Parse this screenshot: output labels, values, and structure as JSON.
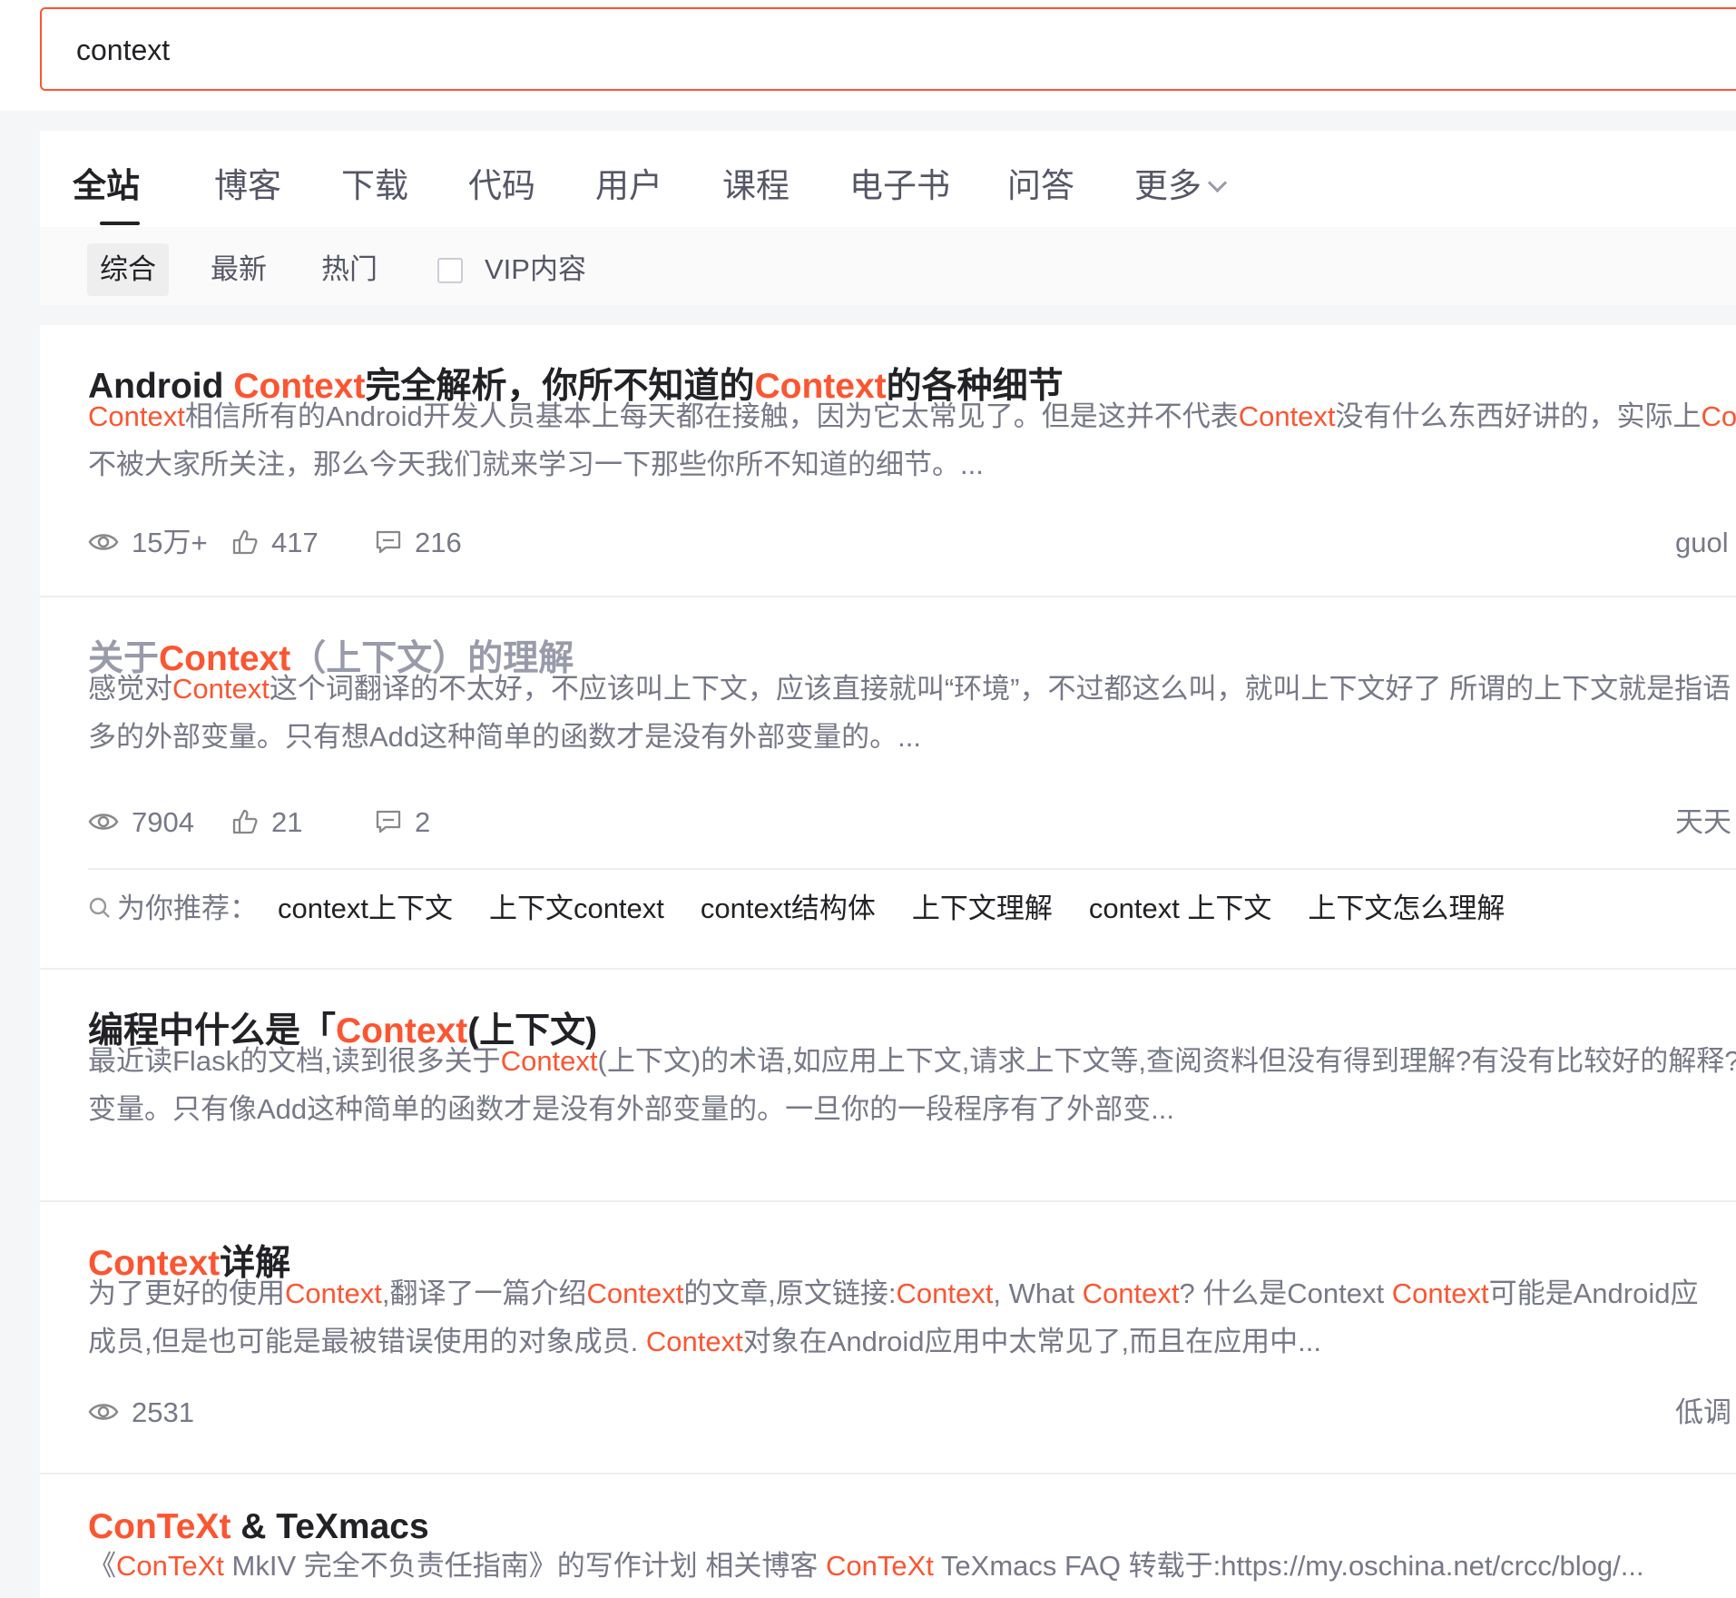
{
  "search": {
    "value": "context"
  },
  "tabs": [
    {
      "label": "全站"
    },
    {
      "label": "博客"
    },
    {
      "label": "下载"
    },
    {
      "label": "代码"
    },
    {
      "label": "用户"
    },
    {
      "label": "课程"
    },
    {
      "label": "电子书"
    },
    {
      "label": "问答"
    },
    {
      "label": "更多"
    }
  ],
  "filters": {
    "items": [
      {
        "label": "综合"
      },
      {
        "label": "最新"
      },
      {
        "label": "热门"
      }
    ],
    "vip_label": "VIP内容",
    "vip_checked": false
  },
  "colors": {
    "accent": "#fc5531",
    "text": "#222226",
    "muted": "#777888"
  },
  "results": [
    {
      "title": [
        "Android ",
        "Context",
        "完全解析，你所不知道的",
        "Context",
        "的各种细节"
      ],
      "desc_line1": [
        "Context",
        "相信所有的Android开发人员基本上每天都在接触，因为它太常见了。但是这并不代表",
        "Context",
        "没有什么东西好讲的，实际上",
        "Co"
      ],
      "desc_line2": "不被大家所关注，那么今天我们就来学习一下那些你所不知道的细节。...",
      "views": "15万+",
      "likes": "417",
      "comments": "216",
      "author": "guol"
    },
    {
      "title": [
        "关于",
        "Context",
        "（上下文）的理解"
      ],
      "desc_line1": [
        "感觉对",
        "Context",
        "这个词翻译的不太好，不应该叫上下文，应该直接就叫“环境”，不过都这么叫，就叫上下文好了 所谓的上下文就是指语"
      ],
      "desc_line2": "多的外部变量。只有想Add这种简单的函数才是没有外部变量的。...",
      "views": "7904",
      "likes": "21",
      "comments": "2",
      "author": "天天"
    },
    {
      "title": [
        "编程中什么是「",
        "Context",
        "(上下文)"
      ],
      "desc_line1": [
        "最近读Flask的文档,读到很多关于",
        "Context",
        "(上下文)的术语,如应用上下文,请求上下文等,查阅资料但没有得到理解?有没有比较好的解释? 每"
      ],
      "desc_line2": "变量。只有像Add这种简单的函数才是没有外部变量的。一旦你的一段程序有了外部变..."
    },
    {
      "title": [
        "Context",
        "详解"
      ],
      "desc_line1": [
        "为了更好的使用",
        "Context",
        ",翻译了一篇介绍",
        "Context",
        "的文章,原文链接:",
        "Context",
        ", What ",
        "Context",
        "? 什么是Context ",
        "Context",
        "可能是Android应"
      ],
      "desc_line2": "成员,但是也可能是最被错误使用的对象成员. ",
      "desc_line2_hl": "Context",
      "desc_line2_rest": "对象在Android应用中太常见了,而且在应用中...",
      "views": "2531",
      "author": "低调"
    },
    {
      "title": [
        "ConTeXt",
        " & TeXmacs"
      ],
      "desc_line1": [
        "《",
        "ConTeXt",
        " MkIV 完全不负责任指南》的写作计划 相关博客 ",
        "ConTeXt",
        " TeXmacs FAQ 转载于:https://my.oschina.net/crcc/blog/..."
      ]
    }
  ],
  "recommend": {
    "label": "为你推荐：",
    "links": [
      "context上下文",
      "上下文context",
      "context结构体",
      "上下文理解",
      "context 上下文",
      "上下文怎么理解"
    ]
  }
}
